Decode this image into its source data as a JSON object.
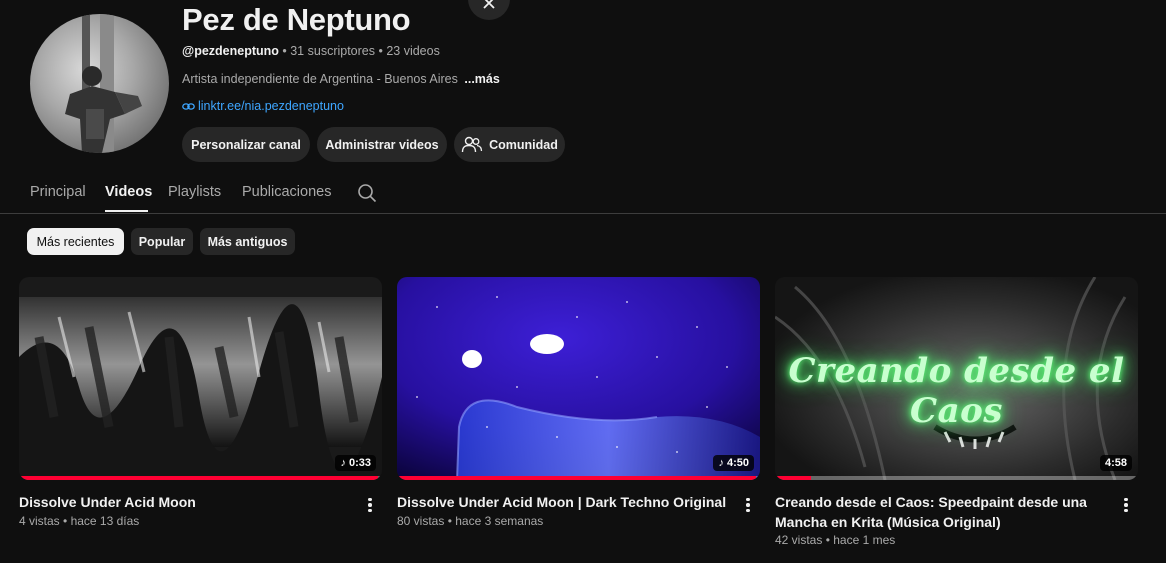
{
  "channel": {
    "name": "Pez de Neptuno",
    "handle": "@pezdeneptuno",
    "subscribers": "31 suscriptores",
    "videos_count": "23 videos",
    "separator": " • ",
    "description": "Artista independiente de Argentina - Buenos Aires",
    "more_label": "...más",
    "link": "linktr.ee/nia.pezdeneptuno"
  },
  "actions": {
    "customize": "Personalizar canal",
    "manage": "Administrar videos",
    "community": "Comunidad"
  },
  "tabs": [
    "Principal",
    "Videos",
    "Playlists",
    "Publicaciones"
  ],
  "active_tab": "Videos",
  "chips": [
    "Más recientes",
    "Popular",
    "Más antiguos"
  ],
  "selected_chip": "Más recientes",
  "videos": [
    {
      "title": "Dissolve Under Acid Moon",
      "duration": "0:33",
      "views": "4 vistas",
      "age": "hace 13 días",
      "watched_fraction": 0.99
    },
    {
      "title": "Dissolve Under Acid Moon | Dark Techno Original",
      "duration": "4:50",
      "views": "80 vistas",
      "age": "hace 3 semanas",
      "watched_fraction": 0.99
    },
    {
      "title": "Creando desde el Caos: Speedpaint desde una Mancha en Krita (Música Original)",
      "thumb_text": "Creando desde el Caos",
      "duration": "4:58",
      "views": "42 vistas",
      "age": "hace 1 mes",
      "watched_fraction": 0.1
    }
  ],
  "colors": {
    "background": "#0f0f0f",
    "chip_bg": "#272727",
    "link": "#3ea6ff",
    "progress": "#ff0033",
    "thumb_text_glow": "#5dff7a"
  }
}
